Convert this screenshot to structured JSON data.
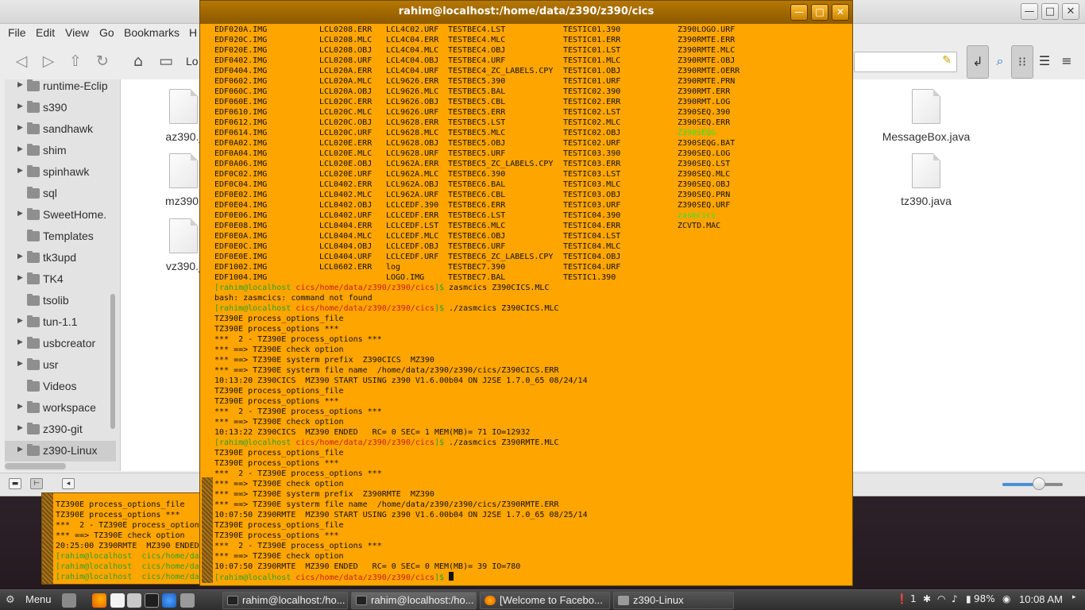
{
  "file_manager": {
    "menu": [
      "File",
      "Edit",
      "View",
      "Go",
      "Bookmarks",
      "H"
    ],
    "location_partial": "Lo",
    "sidebar": [
      {
        "label": "runtime-Eclip",
        "arrow": true
      },
      {
        "label": "s390",
        "arrow": true
      },
      {
        "label": "sandhawk",
        "arrow": true
      },
      {
        "label": "shim",
        "arrow": true
      },
      {
        "label": "spinhawk",
        "arrow": true
      },
      {
        "label": "sql",
        "arrow": false
      },
      {
        "label": "SweetHome.",
        "arrow": true
      },
      {
        "label": "Templates",
        "arrow": false
      },
      {
        "label": "tk3upd",
        "arrow": true
      },
      {
        "label": "TK4",
        "arrow": true
      },
      {
        "label": "tsolib",
        "arrow": false
      },
      {
        "label": "tun-1.1",
        "arrow": true
      },
      {
        "label": "usbcreator",
        "arrow": true
      },
      {
        "label": "usr",
        "arrow": true
      },
      {
        "label": "Videos",
        "arrow": false
      },
      {
        "label": "workspace",
        "arrow": true
      },
      {
        "label": "z390-git",
        "arrow": true
      },
      {
        "label": "z390-Linux",
        "arrow": true
      }
    ],
    "files_left": [
      "az390.j",
      "mz390.",
      "vz390.j"
    ],
    "files_right": [
      "MessageBox.java",
      "tz390.java"
    ],
    "zoom_fraction": 0.62
  },
  "terminal": {
    "title": "rahim@localhost:/home/data/z390/z390/cics",
    "ls_columns": [
      [
        "EDF020A.IMG",
        "EDF020C.IMG",
        "EDF020E.IMG",
        "EDF0402.IMG",
        "EDF0404.IMG",
        "EDF0602.IMG",
        "EDF060C.IMG",
        "EDF060E.IMG",
        "EDF0610.IMG",
        "EDF0612.IMG",
        "EDF0614.IMG",
        "EDF0A02.IMG",
        "EDF0A04.IMG",
        "EDF0A06.IMG",
        "EDF0C02.IMG",
        "EDF0C04.IMG",
        "EDF0E02.IMG",
        "EDF0E04.IMG",
        "EDF0E06.IMG",
        "EDF0E08.IMG",
        "EDF0E0A.IMG",
        "EDF0E0C.IMG",
        "EDF0E0E.IMG",
        "EDF1002.IMG",
        "EDF1004.IMG"
      ],
      [
        "LCL0208.ERR",
        "LCL0208.MLC",
        "LCL0208.OBJ",
        "LCL0208.URF",
        "LCL020A.ERR",
        "LCL020A.MLC",
        "LCL020A.OBJ",
        "LCL020C.ERR",
        "LCL020C.MLC",
        "LCL020C.OBJ",
        "LCL020C.URF",
        "LCL020E.ERR",
        "LCL020E.MLC",
        "LCL020E.OBJ",
        "LCL020E.URF",
        "LCL0402.ERR",
        "LCL0402.MLC",
        "LCL0402.OBJ",
        "LCL0402.URF",
        "LCL0404.ERR",
        "LCL0404.MLC",
        "LCL0404.OBJ",
        "LCL0404.URF",
        "LCL0602.ERR"
      ],
      [
        "LCL4C02.URF",
        "LCL4C04.ERR",
        "LCL4C04.MLC",
        "LCL4C04.OBJ",
        "LCL4C04.URF",
        "LCL9626.ERR",
        "LCL9626.MLC",
        "LCL9626.OBJ",
        "LCL9626.URF",
        "LCL9628.ERR",
        "LCL9628.MLC",
        "LCL9628.OBJ",
        "LCL9628.URF",
        "LCL962A.ERR",
        "LCL962A.MLC",
        "LCL962A.OBJ",
        "LCL962A.URF",
        "LCLCEDF.390",
        "LCLCEDF.ERR",
        "LCLCEDF.LST",
        "LCLCEDF.MLC",
        "LCLCEDF.OBJ",
        "LCLCEDF.URF",
        "log",
        "LOGO.IMG"
      ],
      [
        "TESTBEC4.LST",
        "TESTBEC4.MLC",
        "TESTBEC4.OBJ",
        "TESTBEC4.URF",
        "TESTBEC4_ZC_LABELS.CPY",
        "TESTBEC5.390",
        "TESTBEC5.BAL",
        "TESTBEC5.CBL",
        "TESTBEC5.ERR",
        "TESTBEC5.LST",
        "TESTBEC5.MLC",
        "TESTBEC5.OBJ",
        "TESTBEC5.URF",
        "TESTBEC5_ZC_LABELS.CPY",
        "TESTBEC6.390",
        "TESTBEC6.BAL",
        "TESTBEC6.CBL",
        "TESTBEC6.ERR",
        "TESTBEC6.LST",
        "TESTBEC6.MLC",
        "TESTBEC6.OBJ",
        "TESTBEC6.URF",
        "TESTBEC6_ZC_LABELS.CPY",
        "TESTBEC7.390",
        "TESTBEC7.BAL"
      ],
      [
        "TESTIC01.390",
        "TESTIC01.ERR",
        "TESTIC01.LST",
        "TESTIC01.MLC",
        "TESTIC01.OBJ",
        "TESTIC01.URF",
        "TESTIC02.390",
        "TESTIC02.ERR",
        "TESTIC02.LST",
        "TESTIC02.MLC",
        "TESTIC02.OBJ",
        "TESTIC02.URF",
        "TESTIC03.390",
        "TESTIC03.ERR",
        "TESTIC03.LST",
        "TESTIC03.MLC",
        "TESTIC03.OBJ",
        "TESTIC03.URF",
        "TESTIC04.390",
        "TESTIC04.ERR",
        "TESTIC04.LST",
        "TESTIC04.MLC",
        "TESTIC04.OBJ",
        "TESTIC04.URF",
        "TESTIC1.390"
      ],
      [
        "Z390LOGO.URF",
        "Z390RMTE.ERR",
        "Z390RMTE.MLC",
        "Z390RMTE.OBJ",
        "Z390RMTE.OERR",
        "Z390RMTE.PRN",
        "Z390RMT.ERR",
        "Z390RMT.LOG",
        "Z390SEQ.390",
        "Z390SEQ.ERR",
        "Z390SEQG",
        "Z390SEQG.BAT",
        "Z390SEQ.LOG",
        "Z390SEQ.LST",
        "Z390SEQ.MLC",
        "Z390SEQ.OBJ",
        "Z390SEQ.PRN",
        "Z390SEQ.URF",
        "zasmcics",
        "ZCVTD.MAC"
      ]
    ],
    "green_entries": [
      "Z390SEQG",
      "zasmcics"
    ],
    "prompt_user": "[rahim@localhost ",
    "prompt_path": "cics/home/data/z390/z390/cics",
    "prompt_end": "]$ ",
    "lines": [
      {
        "p": true,
        "t": "zasmcics Z390CICS.MLC"
      },
      {
        "p": false,
        "t": "bash: zasmcics: command not found"
      },
      {
        "p": true,
        "t": "./zasmcics Z390CICS.MLC"
      },
      {
        "p": false,
        "t": "TZ390E process_options_file"
      },
      {
        "p": false,
        "t": "TZ390E process_options ***"
      },
      {
        "p": false,
        "t": "***  2 - TZ390E process_options ***"
      },
      {
        "p": false,
        "t": "*** ==> TZ390E check option"
      },
      {
        "p": false,
        "t": "*** ==> TZ390E systerm prefix  Z390CICS  MZ390"
      },
      {
        "p": false,
        "t": "*** ==> TZ390E systerm file name  /home/data/z390/z390/cics/Z390CICS.ERR"
      },
      {
        "p": false,
        "t": "10:13:20 Z390CICS  MZ390 START USING z390 V1.6.00b04 ON J2SE 1.7.0_65 08/24/14"
      },
      {
        "p": false,
        "t": "TZ390E process_options_file"
      },
      {
        "p": false,
        "t": "TZ390E process_options ***"
      },
      {
        "p": false,
        "t": "***  2 - TZ390E process_options ***"
      },
      {
        "p": false,
        "t": "*** ==> TZ390E check option"
      },
      {
        "p": false,
        "t": "10:13:22 Z390CICS  MZ390 ENDED   RC= 0 SEC= 1 MEM(MB)= 71 IO=12932"
      },
      {
        "p": true,
        "t": "./zasmcics Z390RMTE.MLC"
      },
      {
        "p": false,
        "t": "TZ390E process_options_file"
      },
      {
        "p": false,
        "t": "TZ390E process_options ***"
      },
      {
        "p": false,
        "t": "***  2 - TZ390E process_options ***"
      },
      {
        "p": false,
        "t": "*** ==> TZ390E check option"
      },
      {
        "p": false,
        "t": "*** ==> TZ390E systerm prefix  Z390RMTE  MZ390"
      },
      {
        "p": false,
        "t": "*** ==> TZ390E systerm file name  /home/data/z390/z390/cics/Z390RMTE.ERR"
      },
      {
        "p": false,
        "t": "10:07:50 Z390RMTE  MZ390 START USING z390 V1.6.00b04 ON J2SE 1.7.0_65 08/25/14"
      },
      {
        "p": false,
        "t": "TZ390E process_options_file"
      },
      {
        "p": false,
        "t": "TZ390E process_options ***"
      },
      {
        "p": false,
        "t": "***  2 - TZ390E process_options ***"
      },
      {
        "p": false,
        "t": "*** ==> TZ390E check option"
      },
      {
        "p": false,
        "t": "10:07:50 Z390RMTE  MZ390 ENDED   RC= 0 SEC= 0 MEM(MB)= 39 IO=780"
      },
      {
        "p": true,
        "t": ""
      }
    ]
  },
  "background_terminal": {
    "lines": [
      "TZ390E process_options_file",
      "TZ390E process_options ***",
      "***  2 - TZ390E process_option",
      "*** ==> TZ390E check option",
      "20:25:00 Z390RMTE  MZ390 ENDED",
      "[rahim@localhost  cics/home/da",
      "[rahim@localhost  cics/home/da",
      "[rahim@localhost  cics/home/da"
    ]
  },
  "taskbar": {
    "menu_label": "Menu",
    "tasks": [
      {
        "label": "rahim@localhost:/ho...",
        "active": false
      },
      {
        "label": "rahim@localhost:/ho...",
        "active": true
      },
      {
        "label": "[Welcome to Facebo...",
        "active": false
      },
      {
        "label": "z390-Linux",
        "active": false
      }
    ],
    "tray": {
      "notifications": "1",
      "battery": "98%",
      "clock": "10:08 AM"
    }
  }
}
